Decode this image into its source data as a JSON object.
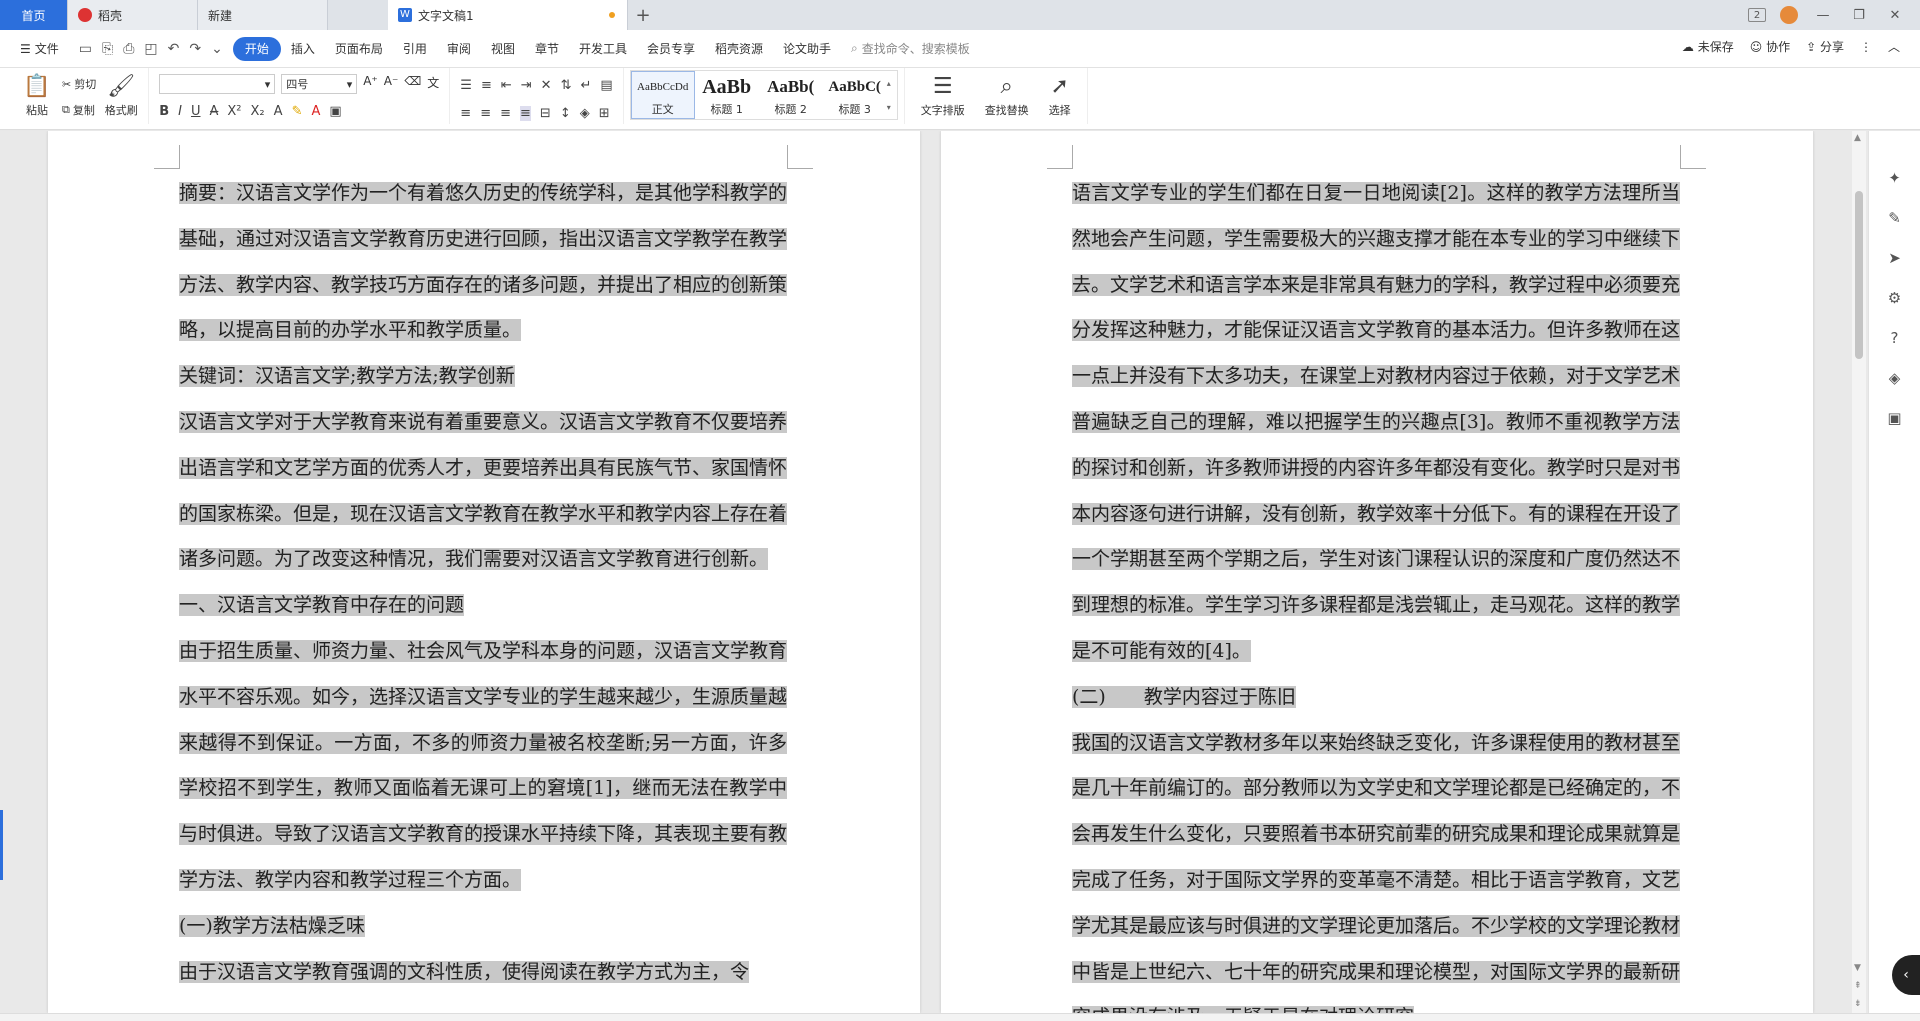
{
  "tabs": {
    "home": "首页",
    "daoke": "稻壳",
    "new": "新建",
    "doc": "文字文稿1",
    "add": "+"
  },
  "window": {
    "badge": "2",
    "min": "—",
    "restore": "❐",
    "close": "✕"
  },
  "menu": {
    "file": "文件",
    "items": [
      "开始",
      "插入",
      "页面布局",
      "引用",
      "审阅",
      "视图",
      "章节",
      "开发工具",
      "会员专享",
      "稻壳资源",
      "论文助手"
    ],
    "search_placeholder": "查找命令、搜索模板",
    "unsaved": "未保存",
    "collab": "协作",
    "share": "分享"
  },
  "ribbon": {
    "paste": "粘贴",
    "cut": "剪切",
    "copy": "复制",
    "format_painter": "格式刷",
    "font_name": "",
    "font_size": "四号",
    "styles": [
      {
        "preview": "AaBbCcDd",
        "label": "正文"
      },
      {
        "preview": "AaBb",
        "label": "标题 1"
      },
      {
        "preview": "AaBb(",
        "label": "标题 2"
      },
      {
        "preview": "AaBbC(",
        "label": "标题 3"
      }
    ],
    "text_layout": "文字排版",
    "find_replace": "查找替换",
    "select": "选择"
  },
  "doc": {
    "page1": [
      "摘要：汉语言文学作为一个有着悠久历史的传统学科，是其他学科教学的基础，通过对汉语言文学教育历史进行回顾，指出汉语言文学教学在教学方法、教学内容、教学技巧方面存在的诸多问题，并提出了相应的创新策略，以提高目前的办学水平和教学质量。",
      "关键词：汉语言文学;教学方法;教学创新",
      "汉语言文学对于大学教育来说有着重要意义。汉语言文学教育不仅要培养出语言学和文艺学方面的优秀人才，更要培养出具有民族气节、家国情怀的国家栋梁。但是，现在汉语言文学教育在教学水平和教学内容上存在着诸多问题。为了改变这种情况，我们需要对汉语言文学教育进行创新。",
      "一、汉语言文学教育中存在的问题",
      "由于招生质量、师资力量、社会风气及学科本身的问题，汉语言文学教育水平不容乐观。如今，选择汉语言文学专业的学生越来越少，生源质量越来越得不到保证。一方面，不多的师资力量被名校垄断;另一方面，许多学校招不到学生，教师又面临着无课可上的窘境[1]，继而无法在教学中与时俱进。导致了汉语言文学教育的授课水平持续下降，其表现主要有教学方法、教学内容和教学过程三个方面。",
      "(一)教学方法枯燥乏味",
      "由于汉语言文学教育强调的文科性质，使得阅读在教学方式为主，令"
    ],
    "page2": [
      "语言文学专业的学生们都在日复一日地阅读[2]。这样的教学方法理所当然地会产生问题，学生需要极大的兴趣支撑才能在本专业的学习中继续下去。文学艺术和语言学本来是非常具有魅力的学科，教学过程中必须要充分发挥这种魅力，才能保证汉语言文学教育的基本活力。但许多教师在这一点上并没有下太多功夫，在课堂上对教材内容过于依赖，对于文学艺术普遍缺乏自己的理解，难以把握学生的兴趣点[3]。教师不重视教学方法的探讨和创新，许多教师讲授的内容许多年都没有变化。教学时只是对书本内容逐句进行讲解，没有创新，教学效率十分低下。有的课程在开设了一个学期甚至两个学期之后，学生对该门课程认识的深度和广度仍然达不到理想的标准。学生学习许多课程都是浅尝辄止，走马观花。这样的教学是不可能有效的[4]。",
      "(二)　　教学内容过于陈旧",
      "我国的汉语言文学教材多年以来始终缺乏变化，许多课程使用的教材甚至是几十年前编订的。部分教师以为文学史和文学理论都是已经确定的，不会再发生什么变化，只要照着书本研究前辈的研究成果和理论成果就算是完成了任务，对于国际文学界的变革毫不清楚。相比于语言学教育，文艺学尤其是最应该与时俱进的文学理论更加落后。不少学校的文学理论教材中皆是上世纪六、七十年的研究成果和理论模型，对国际文学界的最新研究成果没有涉及，无疑于是在对理论研究"
    ]
  }
}
